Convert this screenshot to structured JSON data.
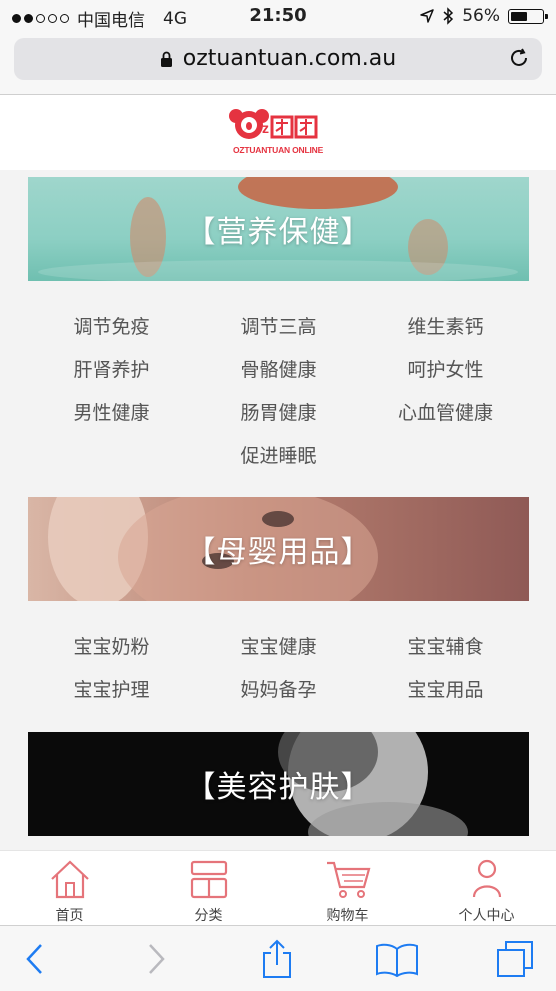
{
  "status_bar": {
    "carrier": "中国电信",
    "network": "4G",
    "time": "21:50",
    "battery": "56%",
    "battery_level": 0.56
  },
  "browser": {
    "url": "oztuantuan.com.au"
  },
  "logo": {
    "text": "OZTUANTUAN ONLINE",
    "brand_color": "#e53340"
  },
  "sections": [
    {
      "title": "【营养保健】",
      "items": [
        "调节免疫",
        "调节三高",
        "维生素钙",
        "肝肾养护",
        "骨骼健康",
        "呵护女性",
        "男性健康",
        "肠胃健康",
        "心血管健康",
        "促进睡眠"
      ]
    },
    {
      "title": "【母婴用品】",
      "items": [
        "宝宝奶粉",
        "宝宝健康",
        "宝宝辅食",
        "宝宝护理",
        "妈妈备孕",
        "宝宝用品"
      ]
    },
    {
      "title": "【美容护肤】",
      "items": []
    }
  ],
  "tabbar": [
    {
      "label": "首页",
      "icon": "home-icon"
    },
    {
      "label": "分类",
      "icon": "category-icon"
    },
    {
      "label": "购物车",
      "icon": "cart-icon"
    },
    {
      "label": "个人中心",
      "icon": "user-icon"
    }
  ],
  "toolbar": [
    "back-icon",
    "forward-icon",
    "share-icon",
    "bookmarks-icon",
    "tabs-icon"
  ],
  "accent_color": "#e5747a"
}
